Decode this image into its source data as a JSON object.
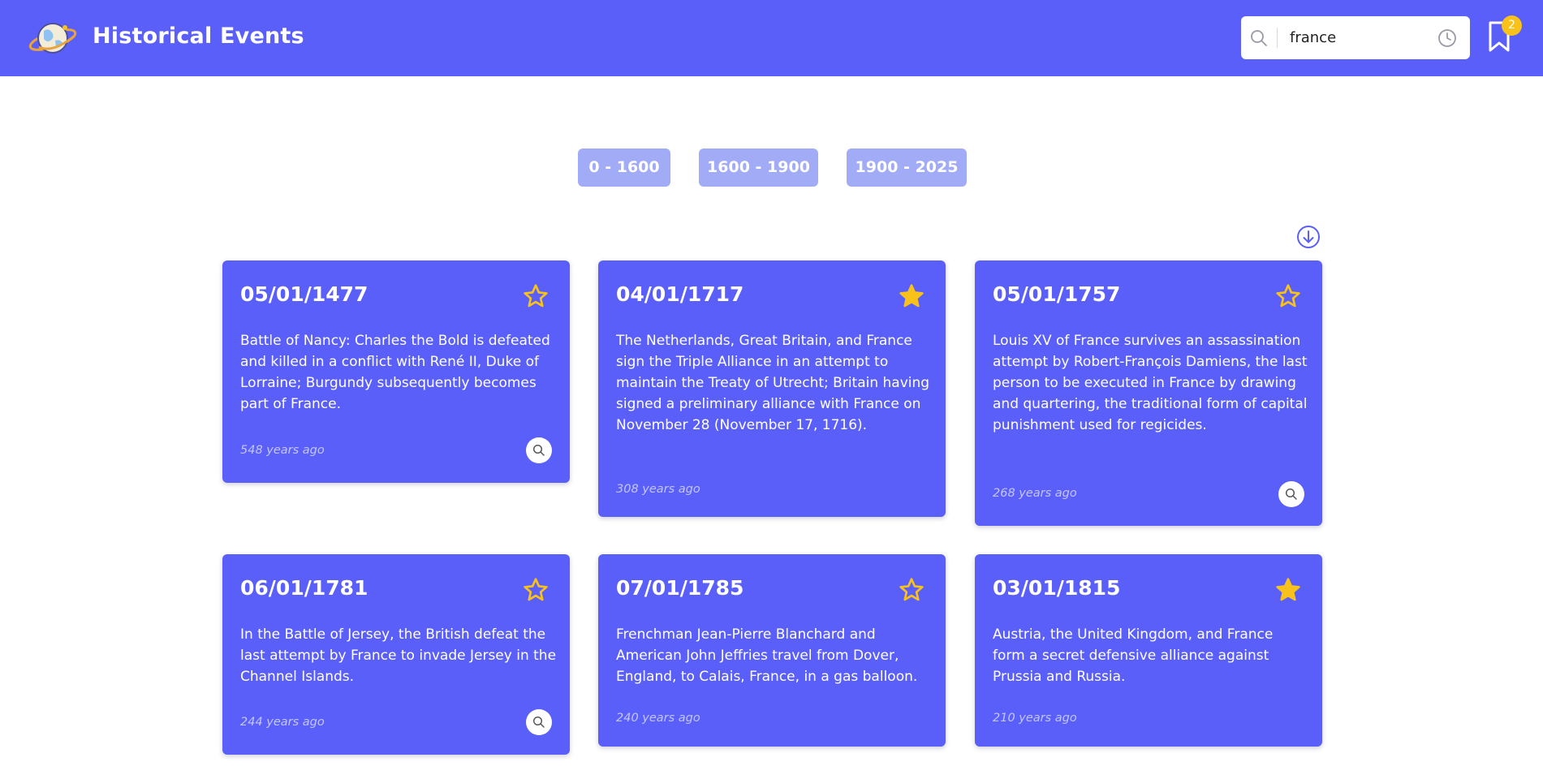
{
  "header": {
    "title": "Historical Events",
    "logo_icon": "planet-globe-logo",
    "bookmark_count": "2",
    "colors": {
      "brand": "#5b5ffa",
      "badge": "#f8c21b"
    }
  },
  "search": {
    "value": "france",
    "search_icon": "search-icon",
    "history_icon": "clock-icon"
  },
  "ranges": [
    {
      "label": "0 - 1600"
    },
    {
      "label": "1600 - 1900"
    },
    {
      "label": "1900 - 2025"
    }
  ],
  "sort_icon": "arrow-down-circle-icon",
  "events": [
    {
      "date": "05/01/1477",
      "favorite": false,
      "description": "Battle of Nancy: Charles the Bold is defeated and killed in a conflict with René II, Duke of Lorraine; Burgundy subsequently becomes part of France.",
      "ago": "548 years ago",
      "has_details": true
    },
    {
      "date": "04/01/1717",
      "favorite": true,
      "description": "The Netherlands, Great Britain, and France sign the Triple Alliance in an attempt to maintain the Treaty of Utrecht; Britain having signed a preliminary alliance with France on November 28 (November 17, 1716).",
      "ago": "308 years ago",
      "has_details": false
    },
    {
      "date": "05/01/1757",
      "favorite": false,
      "description": "Louis XV of France survives an assassination attempt by Robert-François Damiens, the last person to be executed in France by drawing and quartering, the traditional form of capital punishment used for regicides.",
      "ago": "268 years ago",
      "has_details": true
    },
    {
      "date": "06/01/1781",
      "favorite": false,
      "description": "In the Battle of Jersey, the British defeat the last attempt by France to invade Jersey in the Channel Islands.",
      "ago": "244 years ago",
      "has_details": true
    },
    {
      "date": "07/01/1785",
      "favorite": false,
      "description": "Frenchman Jean-Pierre Blanchard and American John Jeffries travel from Dover, England, to Calais, France, in a gas balloon.",
      "ago": "240 years ago",
      "has_details": false
    },
    {
      "date": "03/01/1815",
      "favorite": true,
      "description": "Austria, the United Kingdom, and France form a secret defensive alliance against Prussia and Russia.",
      "ago": "210 years ago",
      "has_details": false
    }
  ]
}
